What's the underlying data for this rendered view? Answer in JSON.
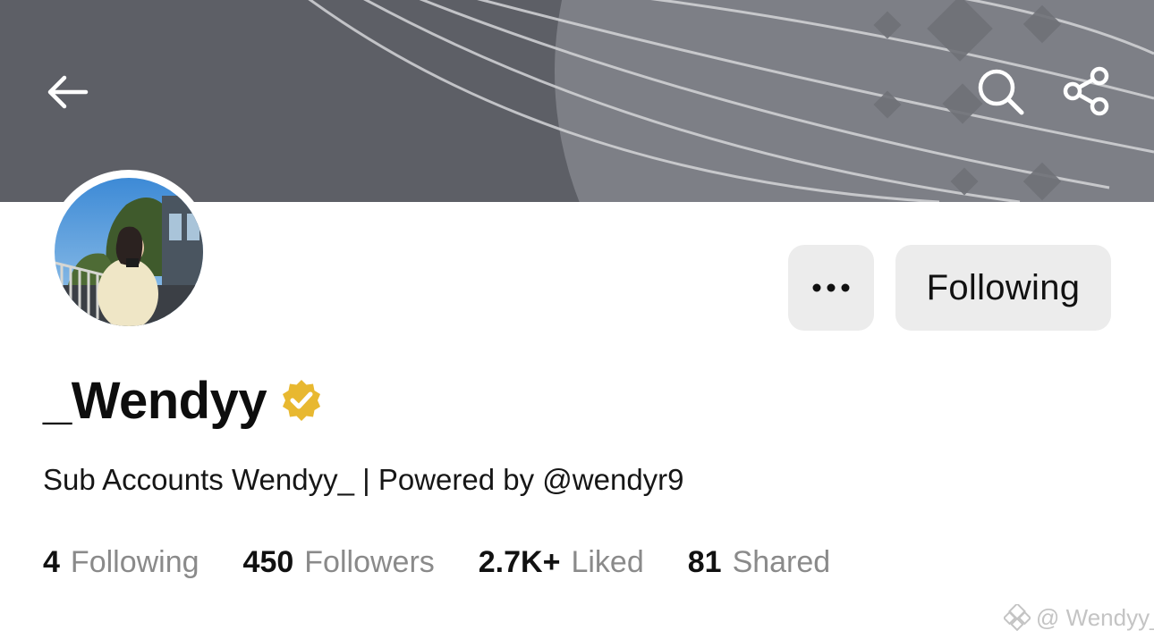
{
  "colors": {
    "banner": "#5d5f66",
    "banner_accent": "#7d7f86",
    "button_bg": "#ececec",
    "verified_badge": "#e8b830",
    "stat_label": "#8a8a8a",
    "watermark": "#c4c4c4"
  },
  "header": {
    "back_icon": "arrow-left-icon",
    "search_icon": "search-icon",
    "share_icon": "share-icon"
  },
  "profile": {
    "display_name": "_Wendyy",
    "verified": true,
    "bio": "Sub Accounts Wendyy_ | Powered by @wendyr9",
    "actions": {
      "more_icon": "more-dots-icon",
      "follow_label": "Following"
    }
  },
  "stats": [
    {
      "value": "4",
      "label": "Following"
    },
    {
      "value": "450",
      "label": "Followers"
    },
    {
      "value": "2.7K+",
      "label": "Liked"
    },
    {
      "value": "81",
      "label": "Shared"
    }
  ],
  "watermark": {
    "text": "@ Wendyy_"
  }
}
